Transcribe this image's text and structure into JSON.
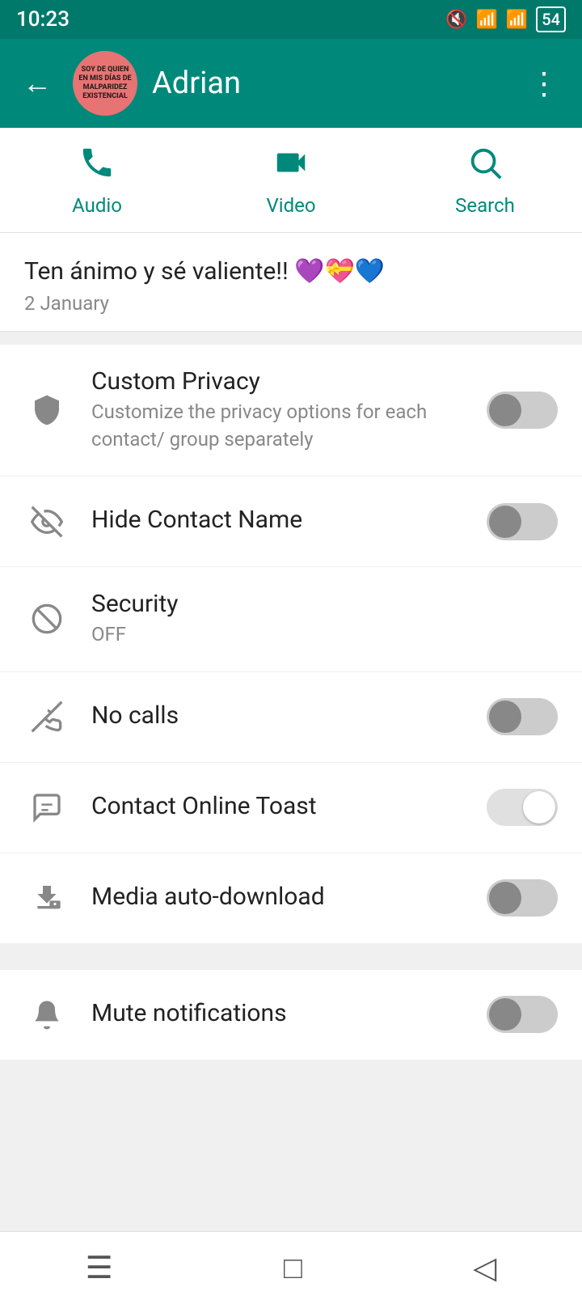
{
  "statusBar": {
    "time": "10:23",
    "battery": "54"
  },
  "header": {
    "contactName": "Adrian",
    "avatarText": "SOY DE QUIEN EN MIS DÍAS DE MALPARIDEZ EXISTENCIAL"
  },
  "actionBar": {
    "audio": {
      "label": "Audio"
    },
    "video": {
      "label": "Video"
    },
    "search": {
      "label": "Search"
    }
  },
  "statusMessage": {
    "text": "Ten ánimo y sé valiente!! 💜💝💙",
    "date": "2 January"
  },
  "settings": [
    {
      "id": "custom-privacy",
      "title": "Custom Privacy",
      "subtitle": "Customize the privacy options for each contact/ group separately",
      "toggleState": "off",
      "hasToggle": true,
      "icon": "shield"
    },
    {
      "id": "hide-contact-name",
      "title": "Hide Contact Name",
      "subtitle": "",
      "toggleState": "off",
      "hasToggle": true,
      "icon": "eye-off"
    },
    {
      "id": "security",
      "title": "Security",
      "subtitle": "OFF",
      "toggleState": "none",
      "hasToggle": false,
      "icon": "blocked"
    },
    {
      "id": "no-calls",
      "title": "No calls",
      "subtitle": "",
      "toggleState": "off",
      "hasToggle": true,
      "icon": "phone-off"
    },
    {
      "id": "contact-online-toast",
      "title": "Contact Online Toast",
      "subtitle": "",
      "toggleState": "on-green",
      "hasToggle": true,
      "icon": "message"
    },
    {
      "id": "media-auto-download",
      "title": "Media auto-download",
      "subtitle": "",
      "toggleState": "off",
      "hasToggle": true,
      "icon": "download-lock"
    }
  ],
  "bottomSettings": [
    {
      "id": "mute-notifications",
      "title": "Mute notifications",
      "subtitle": "",
      "toggleState": "off",
      "hasToggle": true,
      "icon": "bell"
    }
  ],
  "colors": {
    "primary": "#00897B",
    "headerBg": "#00897B"
  }
}
